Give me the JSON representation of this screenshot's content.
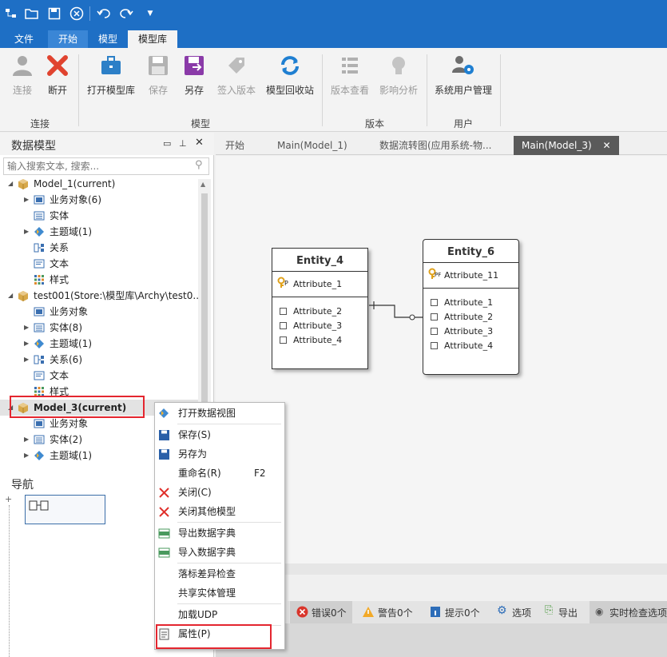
{
  "quick_toolbar": {
    "icons": [
      "app-icon",
      "open-folder-icon",
      "save-icon",
      "close-circle-icon",
      "undo-icon",
      "redo-icon",
      "dropdown-icon"
    ]
  },
  "menu": {
    "tabs": [
      "文件",
      "开始",
      "模型",
      "模型库"
    ],
    "active": "模型库"
  },
  "ribbon": {
    "buttons": [
      {
        "label": "连接",
        "icon": "user-icon",
        "enabled": false
      },
      {
        "label": "断开",
        "icon": "disconnect-icon",
        "enabled": true
      },
      {
        "label": "打开模型库",
        "icon": "briefcase-icon",
        "enabled": true
      },
      {
        "label": "保存",
        "icon": "save-icon",
        "enabled": false
      },
      {
        "label": "另存",
        "icon": "save-as-icon",
        "enabled": true
      },
      {
        "label": "签入版本",
        "icon": "tag-icon",
        "enabled": false
      },
      {
        "label": "模型回收站",
        "icon": "recycle-icon",
        "enabled": true
      },
      {
        "label": "版本查看",
        "icon": "version-list-icon",
        "enabled": false
      },
      {
        "label": "影响分析",
        "icon": "lightbulb-icon",
        "enabled": false
      },
      {
        "label": "系统用户管理",
        "icon": "user-gear-icon",
        "enabled": true
      }
    ],
    "groups": [
      "连接",
      "模型",
      "版本",
      "用户"
    ]
  },
  "left_panel": {
    "title": "数据模型",
    "search_placeholder": "输入搜索文本, 搜索...",
    "tree": [
      {
        "label": "Model_1(current)",
        "level": 0,
        "arrow": "◢"
      },
      {
        "label": "业务对象(6)",
        "level": 1,
        "arrow": "▶"
      },
      {
        "label": "实体",
        "level": 1,
        "arrow": ""
      },
      {
        "label": "主题域(1)",
        "level": 1,
        "arrow": "▶"
      },
      {
        "label": "关系",
        "level": 1,
        "arrow": ""
      },
      {
        "label": "文本",
        "level": 1,
        "arrow": ""
      },
      {
        "label": "样式",
        "level": 1,
        "arrow": ""
      },
      {
        "label": "test001(Store:\\模型库\\Archy\\test0...",
        "level": 0,
        "arrow": "◢"
      },
      {
        "label": "业务对象",
        "level": 1,
        "arrow": ""
      },
      {
        "label": "实体(8)",
        "level": 1,
        "arrow": "▶"
      },
      {
        "label": "主题域(1)",
        "level": 1,
        "arrow": "▶"
      },
      {
        "label": "关系(6)",
        "level": 1,
        "arrow": "▶"
      },
      {
        "label": "文本",
        "level": 1,
        "arrow": ""
      },
      {
        "label": "样式",
        "level": 1,
        "arrow": ""
      },
      {
        "label": "Model_3(current)",
        "level": 0,
        "arrow": "◢",
        "bold": true,
        "selected": true
      },
      {
        "label": "业务对象",
        "level": 1,
        "arrow": ""
      },
      {
        "label": "实体(2)",
        "level": 1,
        "arrow": "▶"
      },
      {
        "label": "主题域(1)",
        "level": 1,
        "arrow": "▶"
      }
    ]
  },
  "nav_panel": {
    "title": "导航"
  },
  "doc_tabs": [
    "开始",
    "Main(Model_1)",
    "数据流转图(应用系统-物...",
    "Main(Model_3)"
  ],
  "active_doc_tab": "Main(Model_3)",
  "diagram": {
    "entities": [
      {
        "name": "Entity_4",
        "key": "Attribute_1",
        "key_tag": "P",
        "attributes": [
          "Attribute_2",
          "Attribute_3",
          "Attribute_4"
        ]
      },
      {
        "name": "Entity_6",
        "key": "Attribute_11",
        "key_tag": "PF",
        "attributes": [
          "Attribute_1",
          "Attribute_2",
          "Attribute_3",
          "Attribute_4"
        ]
      }
    ]
  },
  "status": {
    "errors": "错误0个",
    "warnings": "警告0个",
    "hints": "提示0个",
    "options": "选项",
    "export": "导出",
    "realtime": "实时检查选项"
  },
  "context_menu": {
    "items": [
      {
        "label": "打开数据视图",
        "icon": "diagram-icon",
        "shortcut": ""
      },
      {
        "label": "保存(S)",
        "icon": "save-icon",
        "shortcut": ""
      },
      {
        "label": "另存为",
        "icon": "save-icon",
        "shortcut": ""
      },
      {
        "label": "重命名(R)",
        "icon": "",
        "shortcut": "F2"
      },
      {
        "label": "关闭(C)",
        "icon": "close-x-icon",
        "shortcut": ""
      },
      {
        "label": "关闭其他模型",
        "icon": "close-x-icon",
        "shortcut": ""
      },
      {
        "label": "导出数据字典",
        "icon": "export-dict-icon",
        "shortcut": ""
      },
      {
        "label": "导入数据字典",
        "icon": "import-dict-icon",
        "shortcut": ""
      },
      {
        "label": "落标差异检查",
        "icon": "",
        "shortcut": ""
      },
      {
        "label": "共享实体管理",
        "icon": "",
        "shortcut": ""
      },
      {
        "label": "加载UDP",
        "icon": "",
        "shortcut": ""
      },
      {
        "label": "属性(P)",
        "icon": "properties-icon",
        "shortcut": ""
      }
    ]
  },
  "colors": {
    "titlebar": "#1e6fc5",
    "highlight": "#e4262f",
    "active_tab": "#5a5a5a"
  }
}
